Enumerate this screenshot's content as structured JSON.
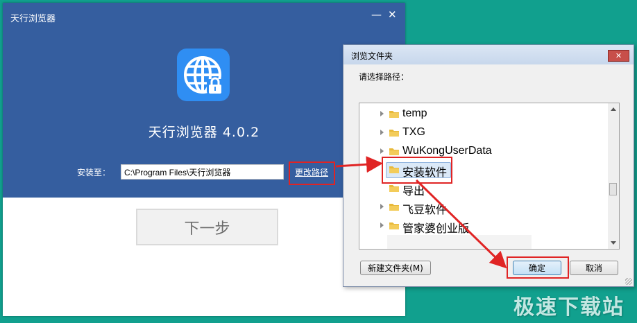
{
  "installer": {
    "title": "天行浏览器",
    "minimize_glyph": "—",
    "close_glyph": "✕",
    "app_icon": "globe-lock-icon",
    "app_name": "天行浏览器  4.0.2",
    "install_to_label": "安装至：",
    "install_path": "C:\\Program Files\\天行浏览器",
    "change_path_link": "更改路径",
    "next_button": "下一步",
    "accent_color": "#355e9f",
    "icon_color": "#2f8ef3"
  },
  "dialog": {
    "title": "浏览文件夹",
    "close_glyph": "✕",
    "prompt": "请选择路径：",
    "tree_items": [
      {
        "label": "temp",
        "expandable": true
      },
      {
        "label": "TXG",
        "expandable": true
      },
      {
        "label": "WuKongUserData",
        "expandable": true
      },
      {
        "label": "安装软件",
        "expandable": false,
        "selected": true
      },
      {
        "label": "导出",
        "expandable": false
      },
      {
        "label": "飞豆软件",
        "expandable": true
      },
      {
        "label": "管家婆创业版",
        "expandable": true
      }
    ],
    "new_folder_button": "新建文件夹(M)",
    "ok_button": "确定",
    "cancel_button": "取消"
  },
  "annotation": {
    "highlight_color": "#e02424",
    "watermark": "极速下载站"
  }
}
